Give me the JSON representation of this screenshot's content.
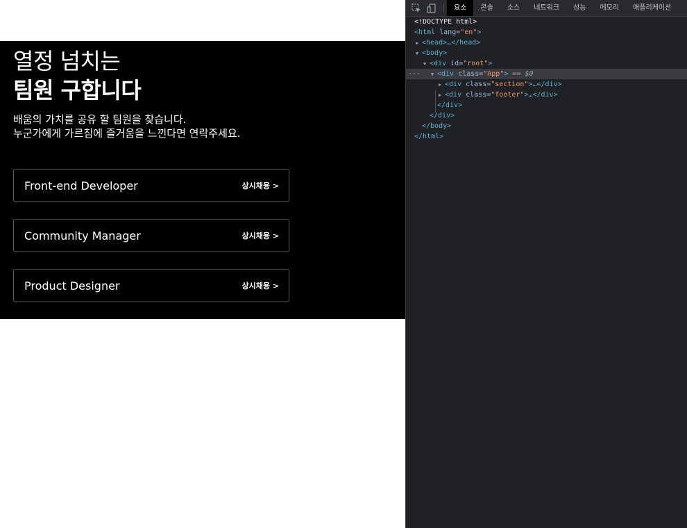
{
  "page": {
    "hero": {
      "title_line1": "열정 넘치는",
      "title_line2": "팀원 구합니다",
      "desc_line1": "배움의 가치를 공유 할 팀원을 찾습니다.",
      "desc_line2": "누군가에게 가르침에 즐거움을 느낀다면 연락주세요."
    },
    "jobs": [
      {
        "title": "Front-end Developer",
        "type": "상시채용 >"
      },
      {
        "title": "Community Manager",
        "type": "상시채용 >"
      },
      {
        "title": "Product Designer",
        "type": "상시채용 >"
      }
    ]
  },
  "devtools": {
    "tabs": [
      "요소",
      "콘솔",
      "소스",
      "네트워크",
      "성능",
      "메모리",
      "애플리케이션"
    ],
    "active_tab": "요소",
    "tree": {
      "doctype": "<!DOCTYPE html>",
      "html_open": "<html",
      "html_attr": " lang=",
      "html_val": "\"en\"",
      "gt": ">",
      "head": "<head>…</head>",
      "body_open": "<body>",
      "div_open": "<div",
      "id_attr": " id=",
      "id_val": "\"root\"",
      "class_attr": " class=",
      "app_val": "\"App\"",
      "section_val": "\"section\"",
      "footer_val": "\"footer\"",
      "collapsed_close": ">…</div>",
      "selected_marker": " == $0",
      "dots": "···",
      "div_close": "</div>",
      "body_close": "</body>",
      "html_close": "</html>"
    }
  },
  "colors": {
    "section_bg": "#000000",
    "devtools_bg": "#202124",
    "tag": "#5db0d7",
    "attr_name": "#9bbbdc",
    "attr_value": "#f29766"
  },
  "icons": [
    "inspect-element-icon",
    "device-toolbar-icon",
    "expand-triangle-icon",
    "collapse-triangle-icon"
  ]
}
